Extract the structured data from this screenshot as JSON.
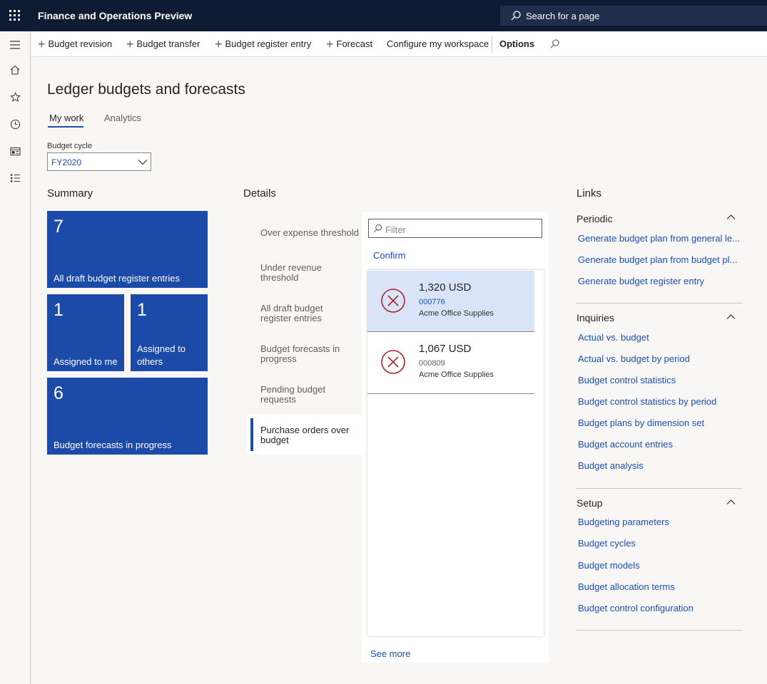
{
  "app": {
    "title": "Finance and Operations Preview"
  },
  "search": {
    "placeholder": "Search for a page"
  },
  "left_nav": {
    "icons": [
      "hamburger-icon",
      "home-icon",
      "star-icon",
      "clock-icon",
      "workspace-icon",
      "list-icon"
    ]
  },
  "actions": {
    "budget_revision": "Budget revision",
    "budget_transfer": "Budget transfer",
    "budget_register_entry": "Budget register entry",
    "forecast": "Forecast",
    "configure": "Configure my workspace",
    "options": "Options"
  },
  "page": {
    "title": "Ledger budgets and forecasts",
    "tabs": [
      {
        "label": "My work",
        "selected": true
      },
      {
        "label": "Analytics",
        "selected": false
      }
    ],
    "budget_cycle": {
      "label": "Budget cycle",
      "value": "FY2020"
    }
  },
  "summary": {
    "heading": "Summary",
    "tiles": [
      {
        "count": "7",
        "label": "All draft budget register entries"
      },
      {
        "count": "1",
        "label": "Assigned to me"
      },
      {
        "count": "1",
        "label": "Assigned to others"
      },
      {
        "count": "6",
        "label": "Budget forecasts in progress"
      }
    ]
  },
  "details": {
    "heading": "Details",
    "items": [
      "Over expense threshold",
      "Under revenue threshold",
      "All draft budget register entries",
      "Budget forecasts in progress",
      "Pending budget requests",
      "Purchase orders over budget"
    ],
    "selected_index": 5,
    "filter_placeholder": "Filter",
    "confirm": "Confirm",
    "see_more": "See more",
    "cards": [
      {
        "amount": "1,320 USD",
        "code": "000776",
        "vendor": "Acme Office Supplies",
        "selected": true
      },
      {
        "amount": "1,067 USD",
        "code": "000809",
        "vendor": "Acme Office Supplies",
        "selected": false
      }
    ]
  },
  "links": {
    "heading": "Links",
    "groups": [
      {
        "title": "Periodic",
        "items": [
          "Generate budget plan from general le...",
          "Generate budget plan from budget pl...",
          "Generate budget register entry"
        ]
      },
      {
        "title": "Inquiries",
        "items": [
          "Actual vs. budget",
          "Actual vs. budget by period",
          "Budget control statistics",
          "Budget control statistics by period",
          "Budget plans by dimension set",
          "Budget account entries",
          "Budget analysis"
        ]
      },
      {
        "title": "Setup",
        "items": [
          "Budgeting parameters",
          "Budget cycles",
          "Budget models",
          "Budget allocation terms",
          "Budget control configuration"
        ]
      }
    ]
  },
  "colors": {
    "topbar": "#0f1b33",
    "tile": "#1c4aa8",
    "link": "#1c4fb4",
    "selected_card": "#dae4f8",
    "error_icon": "#a4262c"
  }
}
